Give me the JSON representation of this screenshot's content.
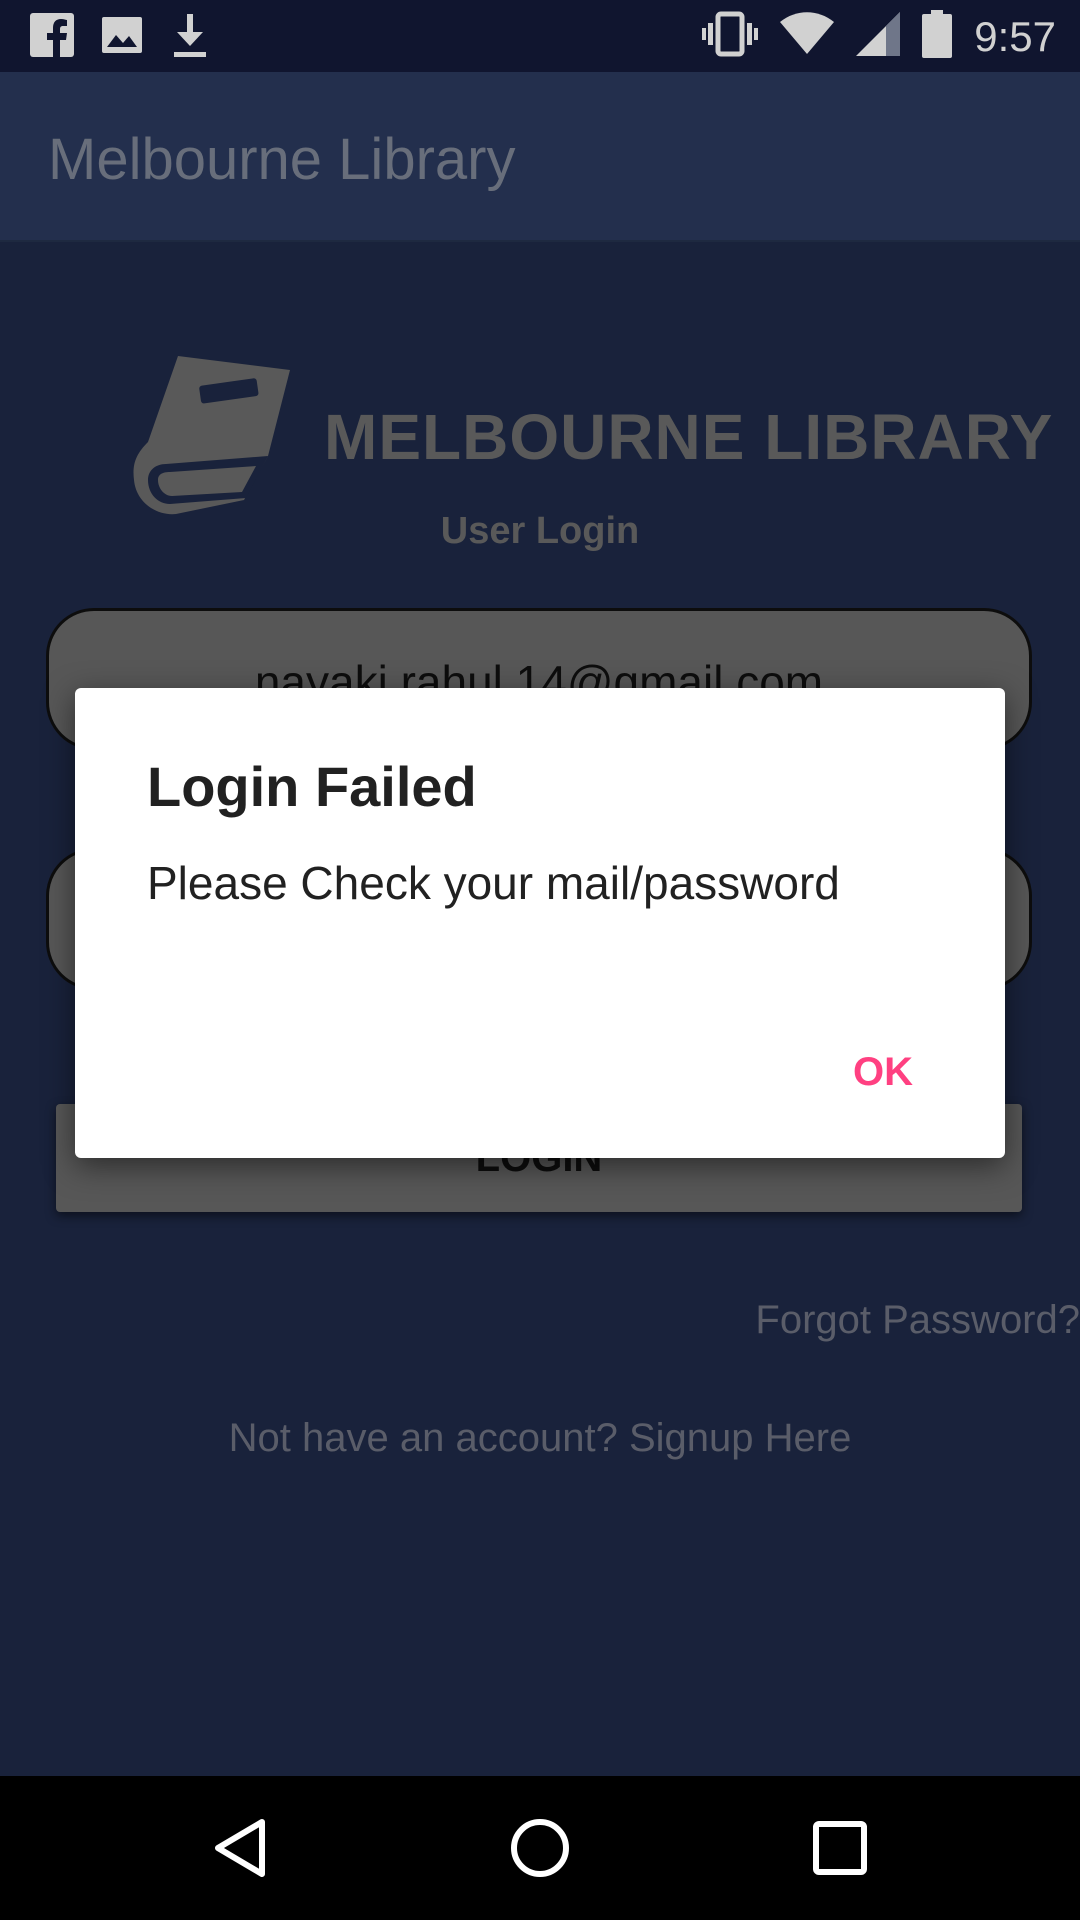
{
  "status_bar": {
    "icons": [
      "facebook-icon",
      "image-icon",
      "download-icon",
      "vibrate-icon",
      "wifi-icon",
      "signal-icon",
      "battery-icon"
    ],
    "time": "9:57"
  },
  "app_bar": {
    "title": "Melbourne Library"
  },
  "login": {
    "logo_title": "MELBOURNE LIBRARY",
    "subtitle": "User Login",
    "email_value": "nayaki.rahul.14@gmail.com",
    "password_value": "",
    "login_label": "LOGIN",
    "forgot_label": "Forgot Password?",
    "signup_label": "Not have an account? Signup Here"
  },
  "dialog": {
    "title": "Login Failed",
    "message": "Please Check your mail/password",
    "ok_label": "OK"
  },
  "colors": {
    "status_bar": "#141a3a",
    "app_bar": "#2b3a5e",
    "background": "#1f2a48",
    "accent": "#ff4081"
  }
}
